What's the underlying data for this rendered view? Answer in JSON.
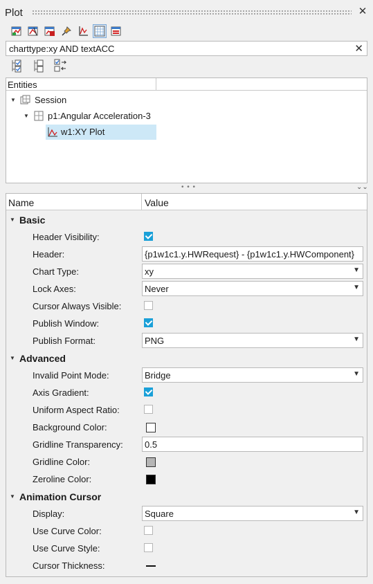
{
  "window": {
    "title": "Plot",
    "close_glyph": "✕"
  },
  "toolbar": {
    "icons": [
      "plot-new-icon",
      "plot-split-icon",
      "plot-delete-icon",
      "plot-pin-icon",
      "plot-axes-icon",
      "plot-grid-icon",
      "plot-legend-icon"
    ],
    "active_index": 5
  },
  "search": {
    "value": "charttype:xy AND textACC",
    "clear_glyph": "✕"
  },
  "tree_toolbar": {
    "icons": [
      "expand-all-icon",
      "collapse-tree-icon",
      "sync-selection-icon"
    ]
  },
  "tree": {
    "header": "Entities",
    "items": [
      {
        "label": "Session",
        "icon": "session-icon",
        "level": 0
      },
      {
        "label": "p1:Angular Acceleration-3",
        "icon": "page-icon",
        "level": 1
      },
      {
        "label": "w1:XY Plot",
        "icon": "xy-plot-icon",
        "level": 2,
        "selected": true
      }
    ]
  },
  "splitter": {
    "glyph": "• • •"
  },
  "properties": {
    "headers": {
      "name": "Name",
      "value": "Value"
    },
    "sections": [
      {
        "title": "Basic",
        "rows": [
          {
            "label": "Header Visibility:",
            "type": "checkbox",
            "checked": true
          },
          {
            "label": "Header:",
            "type": "text",
            "value": "{p1w1c1.y.HWRequest} - {p1w1c1.y.HWComponent}"
          },
          {
            "label": "Chart Type:",
            "type": "combo",
            "value": "xy"
          },
          {
            "label": "Lock Axes:",
            "type": "combo",
            "value": "Never"
          },
          {
            "label": "Cursor Always Visible:",
            "type": "checkbox",
            "checked": false
          },
          {
            "label": "Publish Window:",
            "type": "checkbox",
            "checked": true
          },
          {
            "label": "Publish Format:",
            "type": "combo",
            "value": "PNG"
          }
        ]
      },
      {
        "title": "Advanced",
        "rows": [
          {
            "label": "Invalid Point Mode:",
            "type": "combo",
            "value": "Bridge"
          },
          {
            "label": "Axis Gradient:",
            "type": "checkbox",
            "checked": true
          },
          {
            "label": "Uniform Aspect Ratio:",
            "type": "checkbox",
            "checked": false
          },
          {
            "label": "Background Color:",
            "type": "color",
            "color": "#ffffff"
          },
          {
            "label": "Gridline Transparency:",
            "type": "text",
            "value": "0.5"
          },
          {
            "label": "Gridline Color:",
            "type": "color",
            "color": "#b5b5b5"
          },
          {
            "label": "Zeroline Color:",
            "type": "color",
            "color": "#000000"
          }
        ]
      },
      {
        "title": "Animation Cursor",
        "rows": [
          {
            "label": "Display:",
            "type": "combo",
            "value": "Square"
          },
          {
            "label": "Use Curve Color:",
            "type": "checkbox",
            "checked": false
          },
          {
            "label": "Use Curve Style:",
            "type": "checkbox",
            "checked": false
          },
          {
            "label": "Cursor Thickness:",
            "type": "line",
            "value": ""
          }
        ]
      }
    ]
  },
  "colors": {
    "accent": "#1aa0d8",
    "selection": "#cde8f7"
  }
}
